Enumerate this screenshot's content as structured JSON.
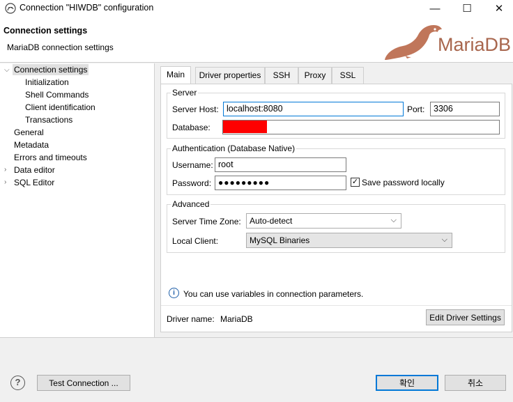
{
  "window": {
    "title": "Connection \"HIWDB\" configuration",
    "minimize_glyph": "—",
    "maximize_glyph": "☐",
    "close_glyph": "✕"
  },
  "header": {
    "title": "Connection settings",
    "subtitle": "MariaDB connection settings",
    "logo_text": "MariaDB"
  },
  "tree": {
    "items": [
      {
        "label": "Connection settings",
        "expanded": true,
        "selected": true
      },
      {
        "label": "Initialization"
      },
      {
        "label": "Shell Commands"
      },
      {
        "label": "Client identification"
      },
      {
        "label": "Transactions"
      },
      {
        "label": "General"
      },
      {
        "label": "Metadata"
      },
      {
        "label": "Errors and timeouts"
      },
      {
        "label": "Data editor",
        "expandable": true
      },
      {
        "label": "SQL Editor",
        "expandable": true
      }
    ]
  },
  "tabs": [
    {
      "label": "Main",
      "active": true
    },
    {
      "label": "Driver properties"
    },
    {
      "label": "SSH"
    },
    {
      "label": "Proxy"
    },
    {
      "label": "SSL"
    }
  ],
  "server": {
    "legend": "Server",
    "host_label": "Server Host:",
    "host_value": "localhost:8080",
    "port_label": "Port:",
    "port_value": "3306",
    "database_label": "Database:",
    "database_value": ""
  },
  "auth": {
    "legend": "Authentication (Database Native)",
    "username_label": "Username:",
    "username_value": "root",
    "password_label": "Password:",
    "password_value": "●●●●●●●●●",
    "save_password_label": "Save password locally",
    "save_password_checked": true
  },
  "advanced": {
    "legend": "Advanced",
    "timezone_label": "Server Time Zone:",
    "timezone_value": "Auto-detect",
    "client_label": "Local Client:",
    "client_value": "MySQL Binaries"
  },
  "info": {
    "text": "You can use variables in connection parameters."
  },
  "driver": {
    "name_label": "Driver name:",
    "name_value": "MariaDB",
    "edit_button": "Edit Driver Settings"
  },
  "footer": {
    "test_button": "Test Connection ...",
    "ok_button": "확인",
    "cancel_button": "취소",
    "help_glyph": "?"
  },
  "colors": {
    "accent": "#0078d7",
    "logo_brown": "#c0765a",
    "logo_text": "#a8664d",
    "redaction": "#ff0000"
  }
}
